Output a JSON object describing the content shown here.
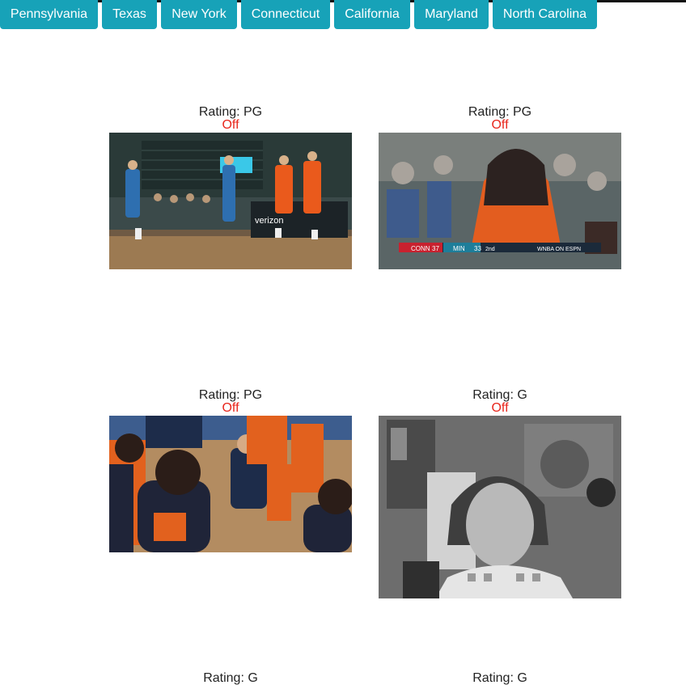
{
  "nav": {
    "tabs": [
      {
        "label": "Pennsylvania"
      },
      {
        "label": "Texas"
      },
      {
        "label": "New York"
      },
      {
        "label": "Connecticut"
      },
      {
        "label": "California"
      },
      {
        "label": "Maryland"
      },
      {
        "label": "North Carolina"
      }
    ]
  },
  "cards": [
    {
      "rating": "Rating: PG",
      "status": "Off",
      "image": "basketball-court-wide-shot"
    },
    {
      "rating": "Rating: PG",
      "status": "Off",
      "image": "basketball-player-closeup-with-scoreboard"
    },
    {
      "rating": "Rating: PG",
      "status": "Off",
      "image": "basketball-team-huddle"
    },
    {
      "rating": "Rating: G",
      "status": "Off",
      "image": "black-and-white-woman-in-kitchen"
    },
    {
      "rating": "Rating: G",
      "status": "",
      "image": ""
    },
    {
      "rating": "Rating: G",
      "status": "",
      "image": ""
    }
  ],
  "scoreboard": {
    "team1": "CONN",
    "score1": "37",
    "team2": "MIN",
    "score2": "33",
    "period": "2nd",
    "network": "WNBA ON ESPN"
  },
  "court_banner": "verizon"
}
